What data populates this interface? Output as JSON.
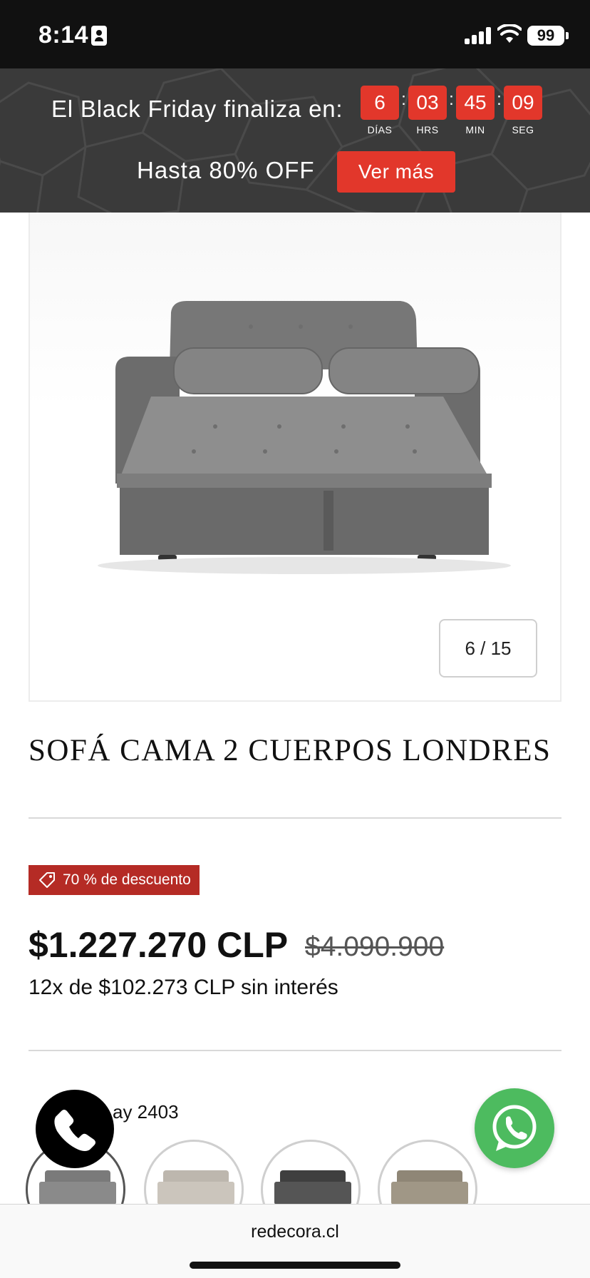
{
  "status_bar": {
    "time": "8:14",
    "battery": "99",
    "icons": [
      "id-card-icon",
      "signal-icon",
      "wifi-icon",
      "battery-icon"
    ]
  },
  "promo": {
    "title": "El Black Friday finaliza en:",
    "countdown": [
      {
        "value": "6",
        "label": "DÍAS"
      },
      {
        "value": "03",
        "label": "HRS"
      },
      {
        "value": "45",
        "label": "MIN"
      },
      {
        "value": "09",
        "label": "SEG"
      }
    ],
    "separator": ":",
    "subtitle": "Hasta 80% OFF",
    "button_label": "Ver más",
    "accent_color": "#e2372b"
  },
  "gallery": {
    "counter": "6 / 15",
    "current": 6,
    "total": 15
  },
  "product": {
    "title": "SOFÁ CAMA 2 CUERPOS LONDRES",
    "discount_badge": "70 % de descuento",
    "price": "$1.227.270 CLP",
    "old_price": "$4.090.900",
    "installments": "12x de $102.273 CLP sin interés",
    "color_label_visible": "ay 2403",
    "swatch_colors": [
      "#7a7a7a",
      "#bdb7ae",
      "#3f3f3f",
      "#8f8676"
    ],
    "badge_color": "#b52b25"
  },
  "floating": {
    "call_icon": "phone-icon",
    "whatsapp_icon": "whatsapp-icon",
    "whatsapp_color": "#4dbb5f"
  },
  "browser": {
    "url": "redecora.cl"
  }
}
